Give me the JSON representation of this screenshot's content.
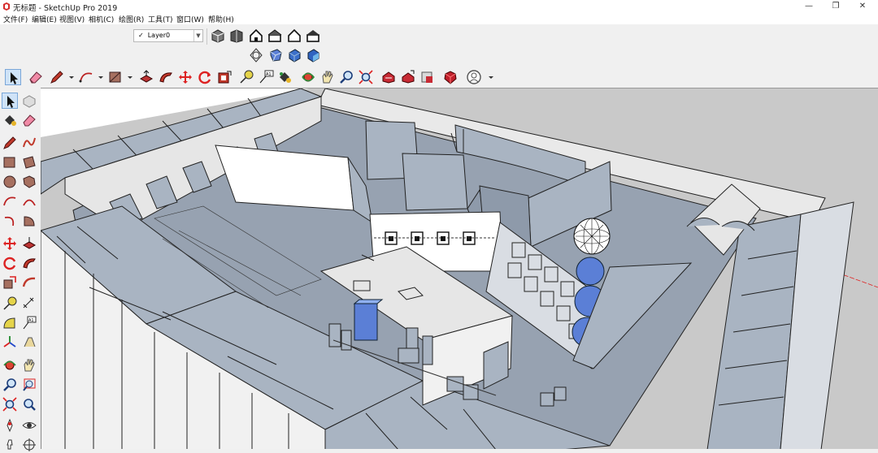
{
  "window": {
    "title": "无标题 - SketchUp Pro 2019",
    "controls": [
      "—",
      "❐",
      "✕"
    ]
  },
  "menu": {
    "items": [
      "文件(F)",
      "编辑(E)",
      "视图(V)",
      "相机(C)",
      "绘图(R)",
      "工具(T)",
      "窗口(W)",
      "帮助(H)"
    ]
  },
  "layers": {
    "current": "Layer0",
    "check": "✓",
    "arrow": "▼"
  },
  "toolbar_icons": {
    "views": [
      "iso-view-icon",
      "top-view-icon",
      "front-view-icon",
      "right-view-icon",
      "back-view-icon",
      "left-view-icon"
    ],
    "styles": [
      "xray-icon",
      "wireframe-icon",
      "hidden-line-icon",
      "shaded-icon"
    ],
    "main": [
      "select-arrow-icon",
      "eraser-icon",
      "pencil-line-icon",
      "arc-icon",
      "rectangle-icon",
      "push-pull-icon",
      "follow-me-icon",
      "move-icon",
      "rotate-icon",
      "offset-icon",
      "tape-measure-icon",
      "text-label-icon",
      "paint-bucket-icon",
      "orbit-icon",
      "pan-icon",
      "zoom-icon",
      "zoom-extents-icon",
      "warehouse-icon",
      "share-model-icon",
      "extension-warehouse-icon",
      "ruby-icon",
      "user-account-icon"
    ],
    "left": [
      "select-arrow-icon",
      "make-component-icon",
      "paint-bucket-icon",
      "eraser-icon",
      "pencil-line-icon",
      "freehand-icon",
      "rectangle-icon",
      "rotated-rectangle-icon",
      "circle-icon",
      "polygon-icon",
      "arc-icon",
      "two-point-arc-icon",
      "three-point-arc-icon",
      "pie-icon",
      "move-icon",
      "push-pull-icon",
      "rotate-icon",
      "follow-me-icon",
      "scale-icon",
      "offset-icon",
      "tape-measure-icon",
      "dimension-icon",
      "protractor-icon",
      "text-label-icon",
      "axes-icon",
      "3d-text-icon",
      "orbit-icon",
      "pan-icon",
      "zoom-icon",
      "zoom-window-icon",
      "zoom-extents-icon",
      "previous-view-icon",
      "position-camera-icon",
      "look-around-icon",
      "walk-icon",
      "section-plane-icon"
    ]
  },
  "colors": {
    "chrome": "#f0f0f0",
    "face_front": "#f1f1f1",
    "face_back": "#a9b4c2",
    "face_back_dark": "#8e9aaa",
    "ground": "#c8c8c8",
    "edge": "#1a1a1a",
    "axis_red": "#e02020",
    "highlight_blue": "#5b7fd6"
  }
}
